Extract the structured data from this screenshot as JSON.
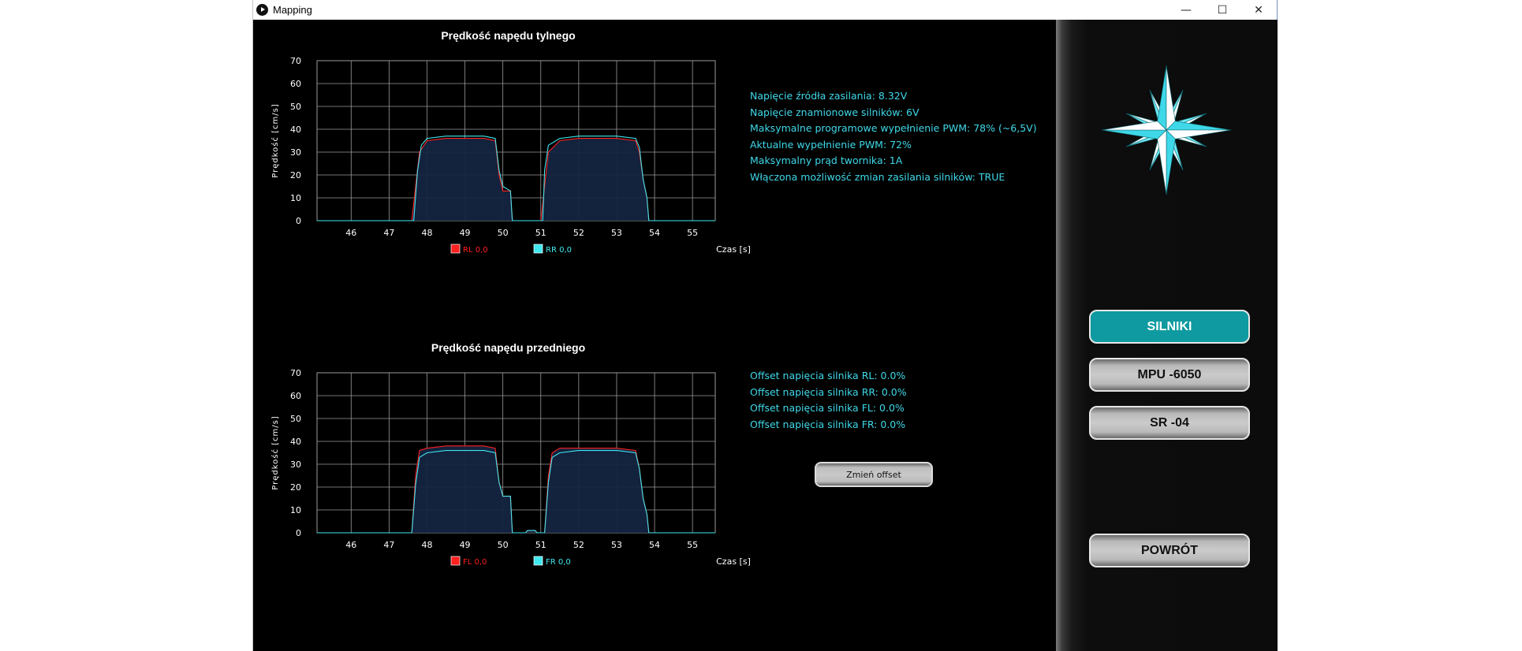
{
  "window": {
    "title": "Mapping",
    "minimize": "—",
    "maximize": "☐",
    "close": "✕"
  },
  "charts": {
    "rear": {
      "title": "Prędkość napędu tylnego",
      "ylabel": "Prędkość [cm/s]",
      "xlabel": "Czas [s]",
      "legend": [
        {
          "label": "RL 0,0",
          "color": "#ff2020"
        },
        {
          "label": "RR 0,0",
          "color": "#40e8f0"
        }
      ]
    },
    "front": {
      "title": "Prędkość napędu przedniego",
      "ylabel": "Prędkość [cm/s]",
      "xlabel": "Czas [s]",
      "legend": [
        {
          "label": "FL 0,0",
          "color": "#ff2020"
        },
        {
          "label": "FR 0,0",
          "color": "#40e8f0"
        }
      ]
    }
  },
  "chart_data": [
    {
      "type": "line",
      "title": "Prędkość napędu tylnego",
      "xlabel": "Czas [s]",
      "ylabel": "Prędkość [cm/s]",
      "xlim": [
        45.1,
        55.6
      ],
      "ylim": [
        0,
        70
      ],
      "x_ticks": [
        46,
        47,
        48,
        49,
        50,
        51,
        52,
        53,
        54,
        55
      ],
      "y_ticks": [
        0,
        10,
        20,
        30,
        40,
        50,
        60,
        70
      ],
      "grid": true,
      "legend_position": "bottom",
      "series": [
        {
          "name": "RL 0,0",
          "color": "#ff2020",
          "x": [
            45.1,
            47.6,
            47.7,
            47.8,
            48.0,
            48.5,
            49.0,
            49.5,
            49.8,
            49.9,
            50.0,
            50.2,
            50.25,
            51.0,
            51.1,
            51.2,
            51.5,
            52.0,
            52.5,
            53.0,
            53.5,
            53.6,
            53.7,
            53.8,
            53.85,
            55.6
          ],
          "y": [
            0,
            0,
            15,
            30,
            35,
            36,
            36,
            36,
            35,
            20,
            13,
            13,
            0,
            0,
            15,
            30,
            35,
            36,
            36,
            36,
            35,
            30,
            18,
            10,
            0,
            0
          ]
        },
        {
          "name": "RR 0,0",
          "color": "#40e8f0",
          "x": [
            45.1,
            47.65,
            47.75,
            47.85,
            48.0,
            48.5,
            49.0,
            49.5,
            49.8,
            49.9,
            50.0,
            50.2,
            50.25,
            51.05,
            51.1,
            51.2,
            51.5,
            52.0,
            52.5,
            53.0,
            53.5,
            53.6,
            53.7,
            53.8,
            53.85,
            55.6
          ],
          "y": [
            0,
            0,
            22,
            33,
            36,
            37,
            37,
            37,
            36,
            22,
            15,
            13,
            0,
            0,
            22,
            33,
            36,
            37,
            37,
            37,
            36,
            32,
            18,
            10,
            0,
            0
          ]
        }
      ]
    },
    {
      "type": "line",
      "title": "Prędkość napędu przedniego",
      "xlabel": "Czas [s]",
      "ylabel": "Prędkość [cm/s]",
      "xlim": [
        45.1,
        55.6
      ],
      "ylim": [
        0,
        70
      ],
      "x_ticks": [
        46,
        47,
        48,
        49,
        50,
        51,
        52,
        53,
        54,
        55
      ],
      "y_ticks": [
        0,
        10,
        20,
        30,
        40,
        50,
        60,
        70
      ],
      "grid": true,
      "legend_position": "bottom",
      "series": [
        {
          "name": "FL 0,0",
          "color": "#ff2020",
          "x": [
            45.1,
            47.6,
            47.7,
            47.8,
            48.0,
            48.5,
            49.0,
            49.5,
            49.8,
            49.9,
            50.0,
            50.2,
            50.25,
            50.6,
            50.65,
            50.85,
            50.9,
            51.1,
            51.2,
            51.3,
            51.5,
            52.0,
            52.5,
            53.0,
            53.5,
            53.6,
            53.7,
            53.8,
            53.85,
            55.6
          ],
          "y": [
            0,
            0,
            25,
            36,
            37,
            38,
            38,
            38,
            37,
            22,
            16,
            16,
            0,
            0,
            1,
            1,
            0,
            0,
            25,
            35,
            37,
            37,
            37,
            37,
            36,
            28,
            15,
            8,
            0,
            0
          ]
        },
        {
          "name": "FR 0,0",
          "color": "#40e8f0",
          "x": [
            45.1,
            47.6,
            47.7,
            47.8,
            48.0,
            48.5,
            49.0,
            49.5,
            49.8,
            49.9,
            50.0,
            50.2,
            50.25,
            50.6,
            50.65,
            50.85,
            50.9,
            51.1,
            51.2,
            51.3,
            51.5,
            52.0,
            52.5,
            53.0,
            53.5,
            53.6,
            53.7,
            53.8,
            53.85,
            55.6
          ],
          "y": [
            0,
            0,
            21,
            33,
            35,
            36,
            36,
            36,
            35,
            22,
            16,
            16,
            0,
            0,
            1,
            1,
            0,
            0,
            22,
            33,
            35,
            36,
            36,
            36,
            35,
            28,
            15,
            8,
            0,
            0
          ]
        }
      ]
    }
  ],
  "info_top": [
    "Napięcie źródła zasilania: 8.32V",
    "Napięcie znamionowe silników: 6V",
    "Maksymalne programowe wypełnienie PWM: 78% (~6,5V)",
    "Aktualne wypełnienie PWM: 72%",
    "Maksymalny prąd twornika: 1A",
    "Włączona możliwość zmian zasilania silników: TRUE"
  ],
  "info_offsets": [
    "Offset napięcia silnika RL: 0.0%",
    "Offset napięcia silnika RR: 0.0%",
    "Offset napięcia silnika FL: 0.0%",
    "Offset napięcia silnika FR: 0.0%"
  ],
  "offset_button": "Zmień offset",
  "side_buttons": {
    "silniki": "SILNIKI",
    "mpu": "MPU -6050",
    "sr": "SR -04",
    "back": "POWRÓT"
  },
  "colors": {
    "accent": "#0e9aa0",
    "text_cyan": "#3fd8e8",
    "grid": "#9a9a9a",
    "fill": "#142440"
  },
  "icons": {
    "logo": "compass-star-icon",
    "app": "play-circle-icon"
  }
}
